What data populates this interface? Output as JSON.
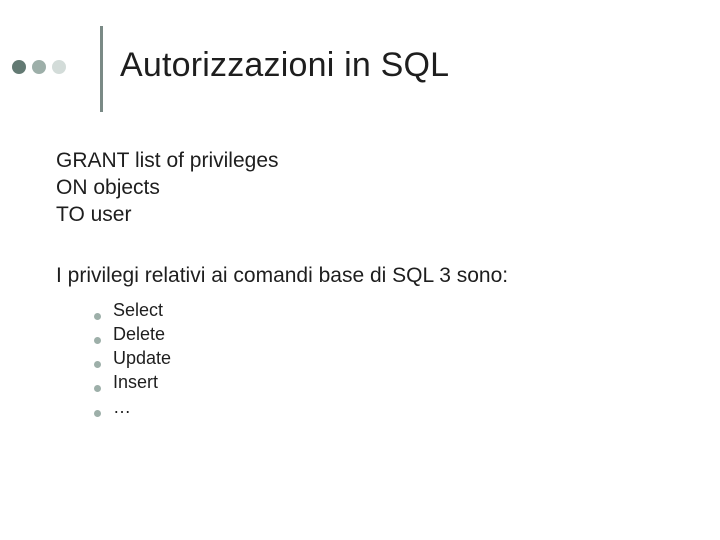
{
  "title": "Autorizzazioni in SQL",
  "grant": {
    "line1": "GRANT list of privileges",
    "line2": "ON objects",
    "line3": "TO user"
  },
  "privileges_heading": "I privilegi relativi ai comandi base di SQL 3 sono:",
  "privileges": {
    "item1": "Select",
    "item2": "Delete",
    "item3": "Update",
    "item4": "Insert",
    "item5": "…"
  },
  "colors": {
    "bullet_dark": "#637a73",
    "bullet_mid": "#9dafa9",
    "bullet_light": "#d3dcd9",
    "rule": "#7a8a86"
  }
}
